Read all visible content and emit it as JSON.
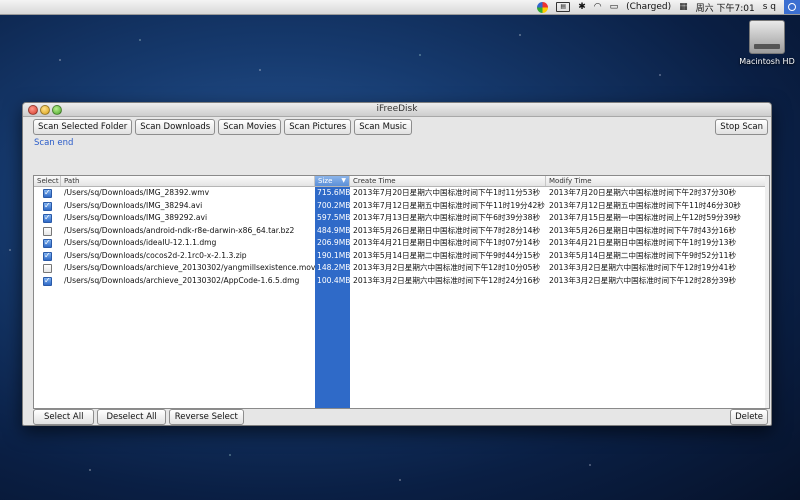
{
  "menubar": {
    "charged": "(Charged)",
    "clock": "周六 下午7:01",
    "user": "s q"
  },
  "desktop": {
    "hd_label": "Macintosh HD"
  },
  "window": {
    "title": "iFreeDisk",
    "buttons": [
      "Scan Selected Folder",
      "Scan Downloads",
      "Scan Movies",
      "Scan Pictures",
      "Scan Music"
    ],
    "stop": "Stop Scan",
    "status": "Scan end"
  },
  "table": {
    "headers": {
      "select": "Select",
      "path": "Path",
      "size": "Size",
      "create": "Create Time",
      "modify": "Modify Time"
    },
    "rows": [
      {
        "checked": true,
        "path": "/Users/sq/Downloads/IMG_28392.wmv",
        "size": "715.6MB",
        "create": "2013年7月20日星期六中国标准时间下午1时11分53秒",
        "modify": "2013年7月20日星期六中国标准时间下午2时37分30秒"
      },
      {
        "checked": true,
        "path": "/Users/sq/Downloads/IMG_38294.avi",
        "size": "700.2MB",
        "create": "2013年7月12日星期五中国标准时间下午11时19分42秒",
        "modify": "2013年7月12日星期五中国标准时间下午11时46分30秒"
      },
      {
        "checked": true,
        "path": "/Users/sq/Downloads/IMG_389292.avi",
        "size": "597.5MB",
        "create": "2013年7月13日星期六中国标准时间下午6时39分38秒",
        "modify": "2013年7月15日星期一中国标准时间上午12时59分39秒"
      },
      {
        "checked": false,
        "path": "/Users/sq/Downloads/android-ndk-r8e-darwin-x86_64.tar.bz2",
        "size": "484.9MB",
        "create": "2013年5月26日星期日中国标准时间下午7时28分14秒",
        "modify": "2013年5月26日星期日中国标准时间下午7时43分16秒"
      },
      {
        "checked": true,
        "path": "/Users/sq/Downloads/ideaIU-12.1.1.dmg",
        "size": "206.9MB",
        "create": "2013年4月21日星期日中国标准时间下午1时07分14秒",
        "modify": "2013年4月21日星期日中国标准时间下午1时19分13秒"
      },
      {
        "checked": true,
        "path": "/Users/sq/Downloads/cocos2d-2.1rc0-x-2.1.3.zip",
        "size": "190.1MB",
        "create": "2013年5月14日星期二中国标准时间下午9时44分15秒",
        "modify": "2013年5月14日星期二中国标准时间下午9时52分11秒"
      },
      {
        "checked": false,
        "path": "/Users/sq/Downloads/archieve_20130302/yangmillsexistence.mov",
        "size": "148.2MB",
        "create": "2013年3月2日星期六中国标准时间下午12时10分05秒",
        "modify": "2013年3月2日星期六中国标准时间下午12时19分41秒"
      },
      {
        "checked": true,
        "path": "/Users/sq/Downloads/archieve_20130302/AppCode-1.6.5.dmg",
        "size": "100.4MB",
        "create": "2013年3月2日星期六中国标准时间下午12时24分16秒",
        "modify": "2013年3月2日星期六中国标准时间下午12时28分39秒"
      }
    ]
  },
  "bottom": {
    "select_all": "Select All",
    "deselect_all": "Deselect All",
    "reverse": "Reverse Select",
    "delete": "Delete"
  },
  "colors": {
    "accent": "#2f6ac8",
    "status": "#2a5cc9"
  }
}
